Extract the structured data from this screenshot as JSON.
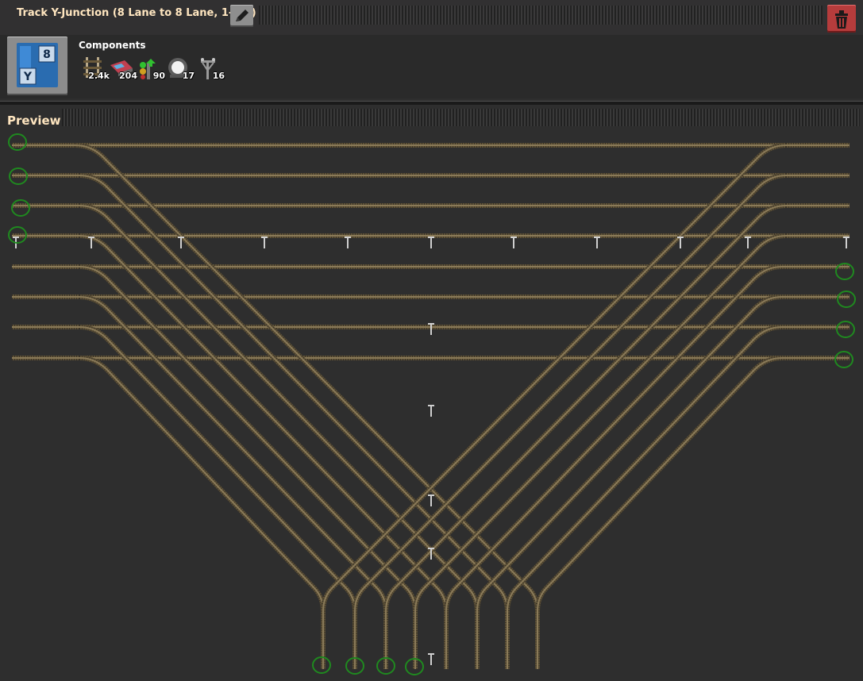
{
  "window": {
    "title": "Track Y-Junction (8 Lane to 8 Lane, 1-4-1)"
  },
  "blueprint_icon": {
    "badge_top": "8",
    "badge_bottom": "Y"
  },
  "components": {
    "label": "Components",
    "items": [
      {
        "icon": "rail-icon",
        "count": "2.4k"
      },
      {
        "icon": "locomotive-icon",
        "count": "204"
      },
      {
        "icon": "rail-signal-icon",
        "count": "90"
      },
      {
        "icon": "lamp-icon",
        "count": "17"
      },
      {
        "icon": "big-electric-pole-icon",
        "count": "16"
      }
    ]
  },
  "preview": {
    "label": "Preview"
  },
  "colors": {
    "rail": "#8a7a58",
    "rail_tie": "#5e5238",
    "marker": "#1f8a1f",
    "accent_text": "#ffe6c0",
    "delete": "#b63c3c"
  }
}
